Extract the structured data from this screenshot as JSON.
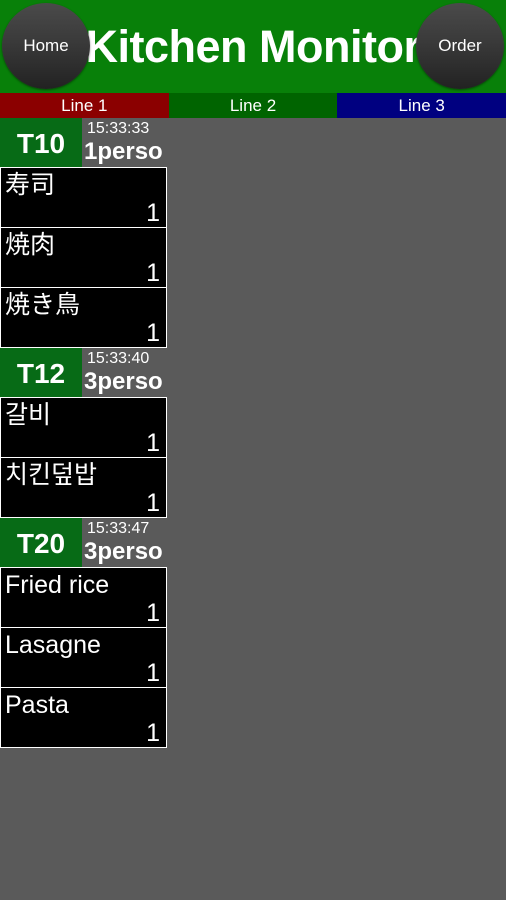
{
  "header": {
    "title": "Kitchen Monitor",
    "home_label": "Home",
    "order_label": "Order",
    "background_color": "#088009"
  },
  "tabs": [
    {
      "label": "Line 1",
      "color": "#8b0000",
      "selected": true
    },
    {
      "label": "Line 2",
      "color": "#006400",
      "selected": false
    },
    {
      "label": "Line 3",
      "color": "#000080",
      "selected": false
    }
  ],
  "orders": [
    {
      "table": "T10",
      "time": "15:33:33",
      "people": "1perso",
      "items": [
        {
          "name": "寿司",
          "qty": "1"
        },
        {
          "name": "焼肉",
          "qty": "1"
        },
        {
          "name": "焼き鳥",
          "qty": "1"
        }
      ]
    },
    {
      "table": "T12",
      "time": "15:33:40",
      "people": "3perso",
      "items": [
        {
          "name": "갈비",
          "qty": "1"
        },
        {
          "name": "치킨덮밥",
          "qty": "1"
        }
      ]
    },
    {
      "table": "T20",
      "time": "15:33:47",
      "people": "3perso",
      "items": [
        {
          "name": "Fried rice",
          "qty": "1"
        },
        {
          "name": "Lasagne",
          "qty": "1"
        },
        {
          "name": "Pasta",
          "qty": "1"
        }
      ]
    }
  ],
  "colors": {
    "page_background": "#5a5a5a",
    "table_block": "#076b16",
    "item_background": "#000000",
    "item_border": "#ffffff"
  }
}
